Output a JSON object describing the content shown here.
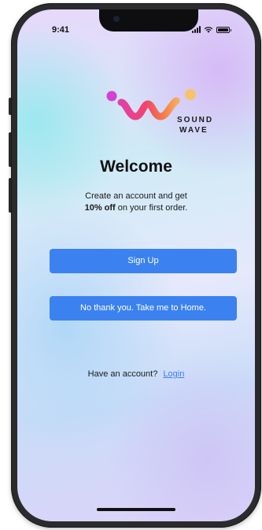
{
  "status_bar": {
    "time": "9:41",
    "icons": [
      "signal-icon",
      "wifi-icon",
      "battery-icon"
    ]
  },
  "brand": {
    "line1": "SOUND",
    "line2": "WAVE",
    "logo_colors": [
      "#d63fd6",
      "#ef4d8f",
      "#f57a4e",
      "#f9c26a"
    ]
  },
  "welcome": {
    "title": "Welcome",
    "subtitle_line1": "Create an account and get",
    "subtitle_bold": "10% off",
    "subtitle_line2_rest": " on your first order."
  },
  "actions": {
    "signup_label": "Sign Up",
    "home_label": "No thank you. Take me to Home."
  },
  "footer": {
    "account_prompt": "Have an account?",
    "login_label": "Login"
  },
  "colors": {
    "accent": "#3b82f0",
    "text": "#1a1a1a",
    "frame": "#2b2b2e"
  }
}
